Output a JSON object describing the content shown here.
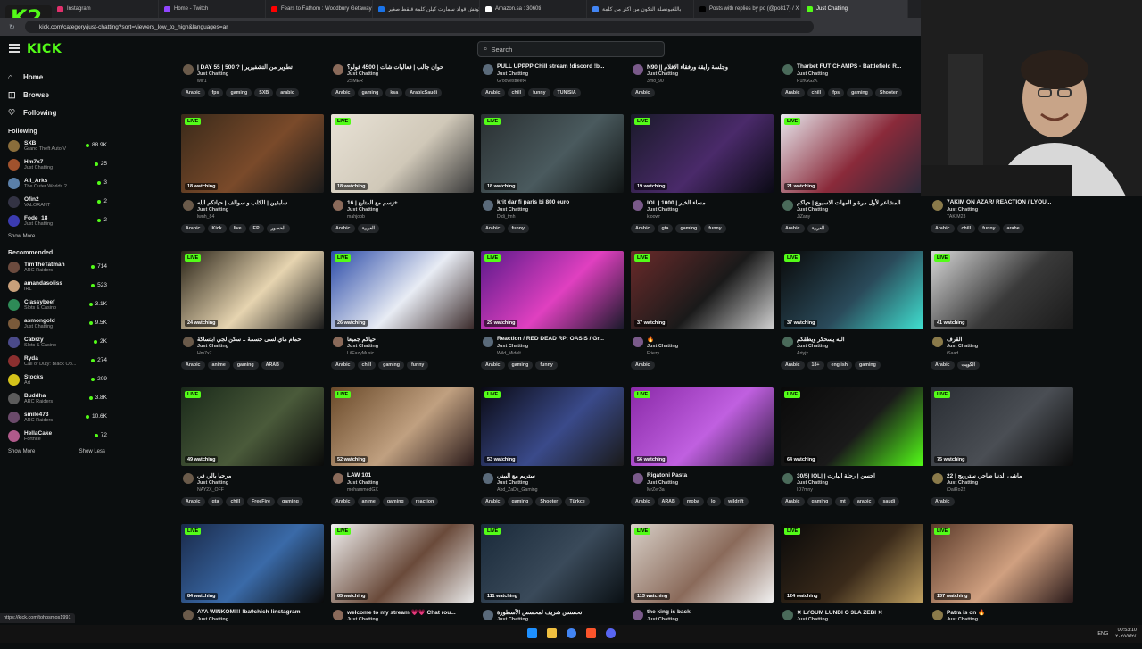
{
  "browser": {
    "tabs": [
      {
        "label": "Instagram",
        "color": "#e1306c"
      },
      {
        "label": "Home - Twitch",
        "color": "#9146ff"
      },
      {
        "label": "Fears to Fathom : Woodbury Getaway",
        "color": "#ff0000"
      },
      {
        "label": "سكوتش قولد سمارت كيلن كلمة قبقط صغير",
        "color": "#1a73e8"
      },
      {
        "label": "Amazon.sa : 3060ti",
        "color": "#ffffff"
      },
      {
        "label": "باللغبونصلة التكون من اكثر من كلمة",
        "color": "#4285f4"
      },
      {
        "label": "Posts with replies by po (@po817) / X",
        "color": "#000000"
      },
      {
        "label": "Just Chatting",
        "color": "#53fc18"
      }
    ],
    "url": "kick.com/category/just-chatting?sort=viewers_low_to_high&languages=ar",
    "status_url": "https://kick.com/tohosmos1991"
  },
  "logo": {
    "text": "K2"
  },
  "kick": {
    "brand": "KICK",
    "search_placeholder": "Search"
  },
  "sidebar": {
    "nav": [
      {
        "label": "Home",
        "icon": "home-icon",
        "glyph": "⌂"
      },
      {
        "label": "Browse",
        "icon": "browse-icon",
        "glyph": "◫"
      },
      {
        "label": "Following",
        "icon": "heart-icon",
        "glyph": "♡"
      }
    ],
    "following_title": "Following",
    "following": [
      {
        "name": "SXB",
        "cat": "Grand Theft Auto V",
        "count": "88.9K",
        "color": "#8a6d3b"
      },
      {
        "name": "Hm7x7",
        "cat": "Just Chatting",
        "count": "25",
        "color": "#a0522d"
      },
      {
        "name": "Ali_Arks",
        "cat": "The Outer Worlds 2",
        "count": "3",
        "color": "#5a7fa8"
      },
      {
        "name": "Ofin2",
        "cat": "VALORANT",
        "count": "2",
        "color": "#333344"
      },
      {
        "name": "Fode_18",
        "cat": "Just Chatting",
        "count": "2",
        "color": "#3b3bb0"
      }
    ],
    "show_more_1": "Show More",
    "recommended_title": "Recommended",
    "recommended": [
      {
        "name": "TimTheTatman",
        "cat": "ARC Raiders",
        "count": "714",
        "color": "#6b4b3e"
      },
      {
        "name": "amandasoliss",
        "cat": "IRL",
        "count": "523",
        "color": "#c9a07a"
      },
      {
        "name": "Classybeef",
        "cat": "Slots & Casino",
        "count": "3.1K",
        "color": "#2e8b57"
      },
      {
        "name": "asmongold",
        "cat": "Just Chatting",
        "count": "9.5K",
        "color": "#7a5a3a"
      },
      {
        "name": "Cabrzy",
        "cat": "Slots & Casino",
        "count": "2K",
        "color": "#4a4a8a"
      },
      {
        "name": "Ryda",
        "cat": "Call of Duty: Black Op...",
        "count": "274",
        "color": "#8b2f2f"
      },
      {
        "name": "Stocks",
        "cat": "Art",
        "count": "209",
        "color": "#d4c21a"
      },
      {
        "name": "Buddha",
        "cat": "ARC Raiders",
        "count": "3.8K",
        "color": "#5b5b5b"
      },
      {
        "name": "smile473",
        "cat": "ARC Raiders",
        "count": "10.6K",
        "color": "#6a4a6a"
      },
      {
        "name": "HellaCake",
        "cat": "Fortnite",
        "count": "72",
        "color": "#b05a8a"
      }
    ],
    "show_more_2": "Show More",
    "show_less": "Show Less"
  },
  "top_row": [
    {
      "title": "| DAY 55 | 500 ? | تطوير من التشفيرير",
      "cat": "Just Chatting",
      "user": "wilr1",
      "tags": [
        "Arabic",
        "fps",
        "gaming",
        "SXB",
        "arabic"
      ]
    },
    {
      "title": "حوان جالب | فعاليات شات | 4500 فولو؟",
      "cat": "Just Chatting",
      "user": "2SMER",
      "tags": [
        "Arabic",
        "gaming",
        "ksa",
        "ArabicSaudi"
      ]
    },
    {
      "title": "PULL UPPPP Chill stream !discord !b...",
      "cat": "Just Chatting",
      "user": "Groovestreet4",
      "tags": [
        "Arabic",
        "chill",
        "funny",
        "TUNISIA"
      ]
    },
    {
      "title": "N90 || وجلسة رايقة ورفقاء الافلام",
      "cat": "Just Chatting",
      "user": "3mo_90",
      "tags": [
        "Arabic"
      ]
    },
    {
      "title": "Tharbet FUT CHAMPS - Battlefield R...",
      "cat": "Just Chatting",
      "user": "P1nGG2K",
      "tags": [
        "Arabic",
        "chill",
        "fps",
        "gaming",
        "Shooter"
      ]
    }
  ],
  "streams": [
    {
      "watching": "18 watching",
      "title": "سابقين | الكلب و سوالف | حياتكم الله",
      "cat": "Just Chatting",
      "user": "lwnh_84",
      "tags": [
        "Arabic",
        "Kick",
        "live",
        "EP",
        "الحضور"
      ],
      "thumb": [
        "#3a2a1a",
        "#7a4a2a",
        "#1a1a1a"
      ]
    },
    {
      "watching": "18 watching",
      "title": "زسم مع المتابع | 16+",
      "cat": "Just Chatting",
      "user": "mahjobb",
      "tags": [
        "Arabic",
        "العربية"
      ],
      "thumb": [
        "#e8e2d6",
        "#d0c8b8",
        "#3a3a3a"
      ]
    },
    {
      "watching": "18 watching",
      "title": "krit dar fi paris bi 800 euro",
      "cat": "Just Chatting",
      "user": "Didi_tmh",
      "tags": [
        "Arabic",
        "funny"
      ],
      "thumb": [
        "#2a3032",
        "#4a5a5e",
        "#101414"
      ]
    },
    {
      "watching": "19 watching",
      "title": "IOL | 1000 | مساء الخير",
      "cat": "Just Chatting",
      "user": "kloowr",
      "tags": [
        "Arabic",
        "gta",
        "gaming",
        "funny"
      ],
      "thumb": [
        "#1a1a2a",
        "#4a2a6a",
        "#0a0a14"
      ]
    },
    {
      "watching": "21 watching",
      "title": "المشاعر لأول مرة و المهات الاسبوع | حياكم",
      "cat": "Just Chatting",
      "user": "JiZany",
      "tags": [
        "Arabic",
        "العربية"
      ],
      "thumb": [
        "#e8e8ee",
        "#8a2a3a",
        "#2a2a3a"
      ]
    },
    {
      "watching": "23 watching",
      "title": "7AKIM ON AZAR/ REACTION / LYOU...",
      "cat": "Just Chatting",
      "user": "7AKIM23",
      "tags": [
        "Arabic",
        "chill",
        "funny",
        "arabe"
      ],
      "thumb": [
        "#2a3a4a",
        "#8a7a6a",
        "#1a1a1a"
      ]
    },
    {
      "watching": "24 watching",
      "title": "حمام ماي لسى جسمة .. سكن لجي ابتساكة",
      "cat": "Just Chatting",
      "user": "Hm7x7",
      "tags": [
        "Arabic",
        "anime",
        "gaming",
        "ARAB"
      ],
      "thumb": [
        "#2a2418",
        "#e6d4b0",
        "#1a1a1a"
      ]
    },
    {
      "watching": "26 watching",
      "title": "حياكم جميعا",
      "cat": "Just Chatting",
      "user": "LilEazyMusic",
      "tags": [
        "Arabic",
        "chill",
        "gaming",
        "funny"
      ],
      "thumb": [
        "#2a4aa8",
        "#e8ecf4",
        "#3a2a2a"
      ]
    },
    {
      "watching": "29 watching",
      "title": "Reaction / RED DEAD RP: OASIS / Gr...",
      "cat": "Just Chatting",
      "user": "Wild_Midelt",
      "tags": [
        "Arabic",
        "gaming",
        "funny"
      ],
      "thumb": [
        "#5a1a8a",
        "#e040c0",
        "#1a1a2a"
      ]
    },
    {
      "watching": "37 watching",
      "title": "🔥",
      "cat": "Just Chatting",
      "user": "Friezy",
      "tags": [
        "Arabic"
      ],
      "thumb": [
        "#6a2a2a",
        "#1a1a1a",
        "#d0d0d0"
      ]
    },
    {
      "watching": "37 watching",
      "title": "الله يسحكر ويطقكم",
      "cat": "Just Chatting",
      "user": "Artyjx",
      "tags": [
        "Arabic",
        "18+",
        "english",
        "gaming"
      ],
      "thumb": [
        "#0a0a0a",
        "#2a4a5a",
        "#40e0d0"
      ]
    },
    {
      "watching": "41 watching",
      "title": "القرف",
      "cat": "Just Chatting",
      "user": "iSaad",
      "tags": [
        "Arabic",
        "الكويت"
      ],
      "thumb": [
        "#d8d8d8",
        "#3a3a3a",
        "#1a1a1a"
      ]
    },
    {
      "watching": "49 watching",
      "title": "مرحبا بالي في",
      "cat": "Just Chatting",
      "user": "NAY2X_OFF",
      "tags": [
        "Arabic",
        "gta",
        "chill",
        "FreeFire",
        "gaming"
      ],
      "thumb": [
        "#1a2a1a",
        "#4a5a3a",
        "#0a0a0a"
      ]
    },
    {
      "watching": "52 watching",
      "title": "LAW 101",
      "cat": "Just Chatting",
      "user": "mohammedGX",
      "tags": [
        "Arabic",
        "anime",
        "gaming",
        "reaction"
      ],
      "thumb": [
        "#6a4a2a",
        "#c0a080",
        "#2a1a1a"
      ]
    },
    {
      "watching": "53 watching",
      "title": "ستريم مع البيني",
      "cat": "Just Chatting",
      "user": "Abd_ZaDs_Gaming",
      "tags": [
        "Arabic",
        "gaming",
        "Shooter",
        "Türkçe"
      ],
      "thumb": [
        "#0a0a14",
        "#3a4a8a",
        "#1a1a1a"
      ]
    },
    {
      "watching": "56 watching",
      "title": "Rigatoni Pasta",
      "cat": "Just Chatting",
      "user": "MrZer3a",
      "tags": [
        "Arabic",
        "ARAB",
        "moba",
        "lol",
        "wildrift"
      ],
      "thumb": [
        "#8a2aa8",
        "#c060e0",
        "#2a1a3a"
      ]
    },
    {
      "watching": "64 watching",
      "title": "30/5| IOL| | احسن | رحلة البارت",
      "cat": "Just Chatting",
      "user": "ID7mny",
      "tags": [
        "Arabic",
        "gaming",
        "mt",
        "arabic",
        "saudi"
      ],
      "thumb": [
        "#0a0a0a",
        "#1a1a1a",
        "#53fc18"
      ]
    },
    {
      "watching": "75 watching",
      "title": "ماشى الدنيا ضاحي سترريج | 22",
      "cat": "Just Chatting",
      "user": "iDaiRo22",
      "tags": [
        "Arabic"
      ],
      "thumb": [
        "#2a2e34",
        "#4a4e54",
        "#0a0a0a"
      ]
    },
    {
      "watching": "84 watching",
      "title": "AYA WINKOM!!! !ba9chich !instagram",
      "cat": "Just Chatting",
      "user": "",
      "tags": [],
      "thumb": [
        "#1a2a4a",
        "#3a6aa8",
        "#0a0a0a"
      ]
    },
    {
      "watching": "85 watching",
      "title": "welcome to my stream 💗💗 Chat rou...",
      "cat": "Just Chatting",
      "user": "",
      "tags": [],
      "thumb": [
        "#f0f0f0",
        "#6a4a3a",
        "#e8e8e8"
      ]
    },
    {
      "watching": "111 watching",
      "title": "تحسنس شريف لمحسس الأسطورة",
      "cat": "Just Chatting",
      "user": "",
      "tags": [],
      "thumb": [
        "#1a2a3a",
        "#3a4a5a",
        "#0a1014"
      ]
    },
    {
      "watching": "113 watching",
      "title": "the king is back",
      "cat": "Just Chatting",
      "user": "",
      "tags": [],
      "thumb": [
        "#d8d0c8",
        "#8a6a5a",
        "#f0f0f0"
      ]
    },
    {
      "watching": "124 watching",
      "title": "✕ LYOUM LUNDI O 3LA ZEBI ✕",
      "cat": "Just Chatting",
      "user": "",
      "tags": [],
      "thumb": [
        "#0a0a0a",
        "#3a2a1a",
        "#c0a060"
      ]
    },
    {
      "watching": "137 watching",
      "title": "Patra is on 🔥",
      "cat": "Just Chatting",
      "user": "",
      "tags": [],
      "thumb": [
        "#5a3a2a",
        "#d0a080",
        "#2a1a1a"
      ]
    }
  ],
  "live_label": "LIVE",
  "taskbar": {
    "lang": "ENG",
    "time": "00:53:10",
    "date": "٢٠٢٥/٧/٢٤"
  },
  "accent": "#53fc18"
}
